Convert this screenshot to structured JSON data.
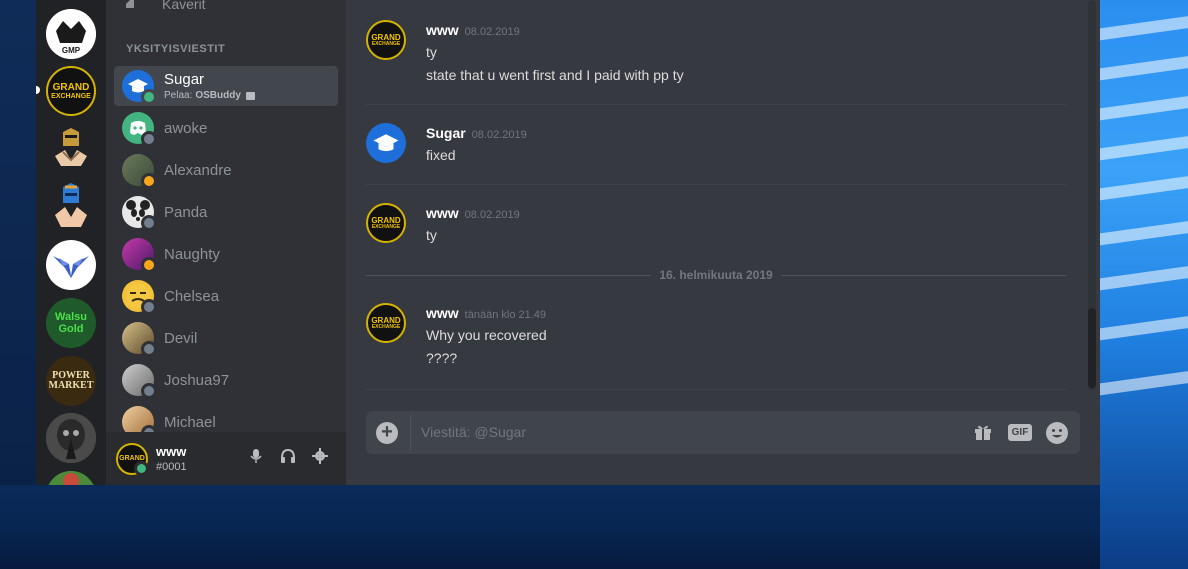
{
  "sidebar": {
    "friends_label": "Kaverit",
    "dm_header": "YKSITYISVIESTIT",
    "dms": [
      {
        "name": "Sugar",
        "activity_prefix": "Pelaa:",
        "activity_game": "OSBuddy",
        "status_color": "#43b581",
        "active": true
      },
      {
        "name": "awoke",
        "status_color": "#747f8d"
      },
      {
        "name": "Alexandre",
        "status_color": "#faa61a"
      },
      {
        "name": "Panda",
        "status_color": "#747f8d"
      },
      {
        "name": "Naughty",
        "status_color": "#faa61a"
      },
      {
        "name": "Chelsea",
        "status_color": "#747f8d"
      },
      {
        "name": "Devil",
        "status_color": "#747f8d"
      },
      {
        "name": "Joshua97",
        "status_color": "#747f8d"
      },
      {
        "name": "Michael",
        "status_color": "#747f8d"
      }
    ]
  },
  "user_panel": {
    "username": "www",
    "tag": "#0001"
  },
  "guilds": {
    "ge_top": "GRAND",
    "ge_bottom": "EXCHANGE",
    "gmp_label": "GMP",
    "walsu_label": "Walsu Gold",
    "power_market_label": "POWER MARKET"
  },
  "chat": {
    "messages": [
      {
        "author": "www",
        "time": "08.02.2019",
        "lines": [
          "ty",
          "state that u went first and I paid with pp ty"
        ]
      },
      {
        "author": "Sugar",
        "time": "08.02.2019",
        "lines": [
          "fixed"
        ]
      },
      {
        "author": "www",
        "time": "08.02.2019",
        "lines": [
          "ty"
        ]
      },
      {
        "author": "www",
        "time": "tänään klo 21.49",
        "lines": [
          "Why you recovered",
          "????"
        ]
      }
    ],
    "date_divider": "16. helmikuuta 2019",
    "composer_placeholder": "Viestitä: @Sugar",
    "gif_label": "GIF"
  },
  "colors": {
    "accent_blurple": "#7289da",
    "online": "#43b581",
    "idle": "#faa61a",
    "offline": "#747f8d",
    "ge_gold": "#f2c400"
  }
}
